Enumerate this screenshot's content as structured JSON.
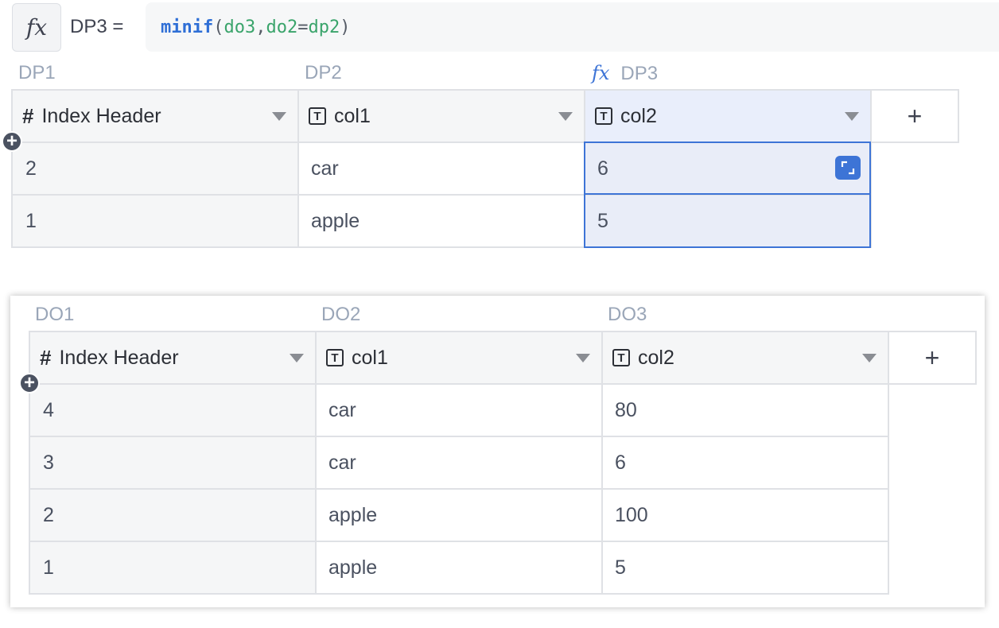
{
  "formula": {
    "icon": "fx-icon",
    "lhs": "DP3 =",
    "fn": "minif",
    "open": "(",
    "arg1": "do3",
    "comma": ",",
    "arg2_key": "do2",
    "eq": "=",
    "arg2_val": "dp2",
    "close": ")"
  },
  "table1": {
    "col_labels": [
      "DP1",
      "DP2",
      "DP3"
    ],
    "fx_marker": "fx",
    "headers": [
      "Index Header",
      "col1",
      "col2"
    ],
    "add_column_label": "+",
    "rows": [
      {
        "index": "2",
        "col1": "car",
        "col2": "6"
      },
      {
        "index": "1",
        "col1": "apple",
        "col2": "5"
      }
    ]
  },
  "table2": {
    "col_labels": [
      "DO1",
      "DO2",
      "DO3"
    ],
    "headers": [
      "Index Header",
      "col1",
      "col2"
    ],
    "add_column_label": "+",
    "rows": [
      {
        "index": "4",
        "col1": "car",
        "col2": "80"
      },
      {
        "index": "3",
        "col1": "car",
        "col2": "6"
      },
      {
        "index": "2",
        "col1": "apple",
        "col2": "100"
      },
      {
        "index": "1",
        "col1": "apple",
        "col2": "5"
      }
    ]
  },
  "colors": {
    "accent": "#3d74d6",
    "formula_fn": "#2f6fd6",
    "formula_arg": "#3aa46b",
    "label": "#9aa6b8"
  }
}
